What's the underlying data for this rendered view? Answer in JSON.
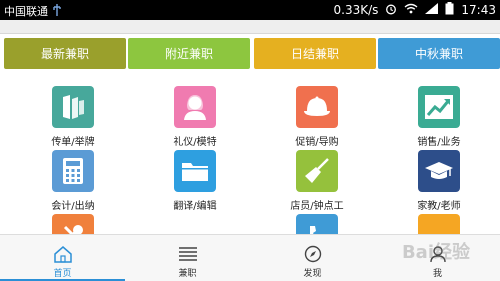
{
  "status_bar": {
    "carrier": "中国联通",
    "speed": "0.33K/s",
    "time": "17:43",
    "icons": [
      "usb-icon",
      "alarm-icon",
      "wifi-icon",
      "signal-icon",
      "battery-icon"
    ]
  },
  "tabs": [
    {
      "label": "最新兼职",
      "color": "#9aa02c"
    },
    {
      "label": "附近兼职",
      "color": "#8dc63f"
    },
    {
      "label": "日结兼职",
      "color": "#e5b020"
    },
    {
      "label": "中秋兼职",
      "color": "#3f9bd6"
    }
  ],
  "grid": [
    {
      "label": "传单/举牌",
      "icon": "flyer-icon",
      "color": "#47a89b"
    },
    {
      "label": "礼仪/模特",
      "icon": "person-icon",
      "color": "#f07bb0"
    },
    {
      "label": "促销/导购",
      "icon": "cap-icon",
      "color": "#f0704e"
    },
    {
      "label": "销售/业务",
      "icon": "chart-up-icon",
      "color": "#3aab93"
    },
    {
      "label": "会计/出纳",
      "icon": "calculator-icon",
      "color": "#5b9bd5"
    },
    {
      "label": "翻译/编辑",
      "icon": "folder-icon",
      "color": "#2e9fe0"
    },
    {
      "label": "店员/钟点工",
      "icon": "broom-icon",
      "color": "#95c13c"
    },
    {
      "label": "家教/老师",
      "icon": "graduation-icon",
      "color": "#2d4e8a"
    },
    {
      "label": "",
      "icon": "tools-icon",
      "color": "#f0803c"
    },
    {
      "label": "",
      "icon": "",
      "color": "#ffffff"
    },
    {
      "label": "",
      "icon": "phone-icon",
      "color": "#3f9bd6"
    },
    {
      "label": "",
      "icon": "",
      "color": "#f5a623"
    }
  ],
  "bottom_nav": [
    {
      "label": "首页",
      "icon": "home-icon",
      "active": true
    },
    {
      "label": "兼职",
      "icon": "list-icon",
      "active": false
    },
    {
      "label": "发现",
      "icon": "compass-icon",
      "active": false
    },
    {
      "label": "我",
      "icon": "user-icon",
      "active": false
    }
  ],
  "watermark": "Bai经验"
}
